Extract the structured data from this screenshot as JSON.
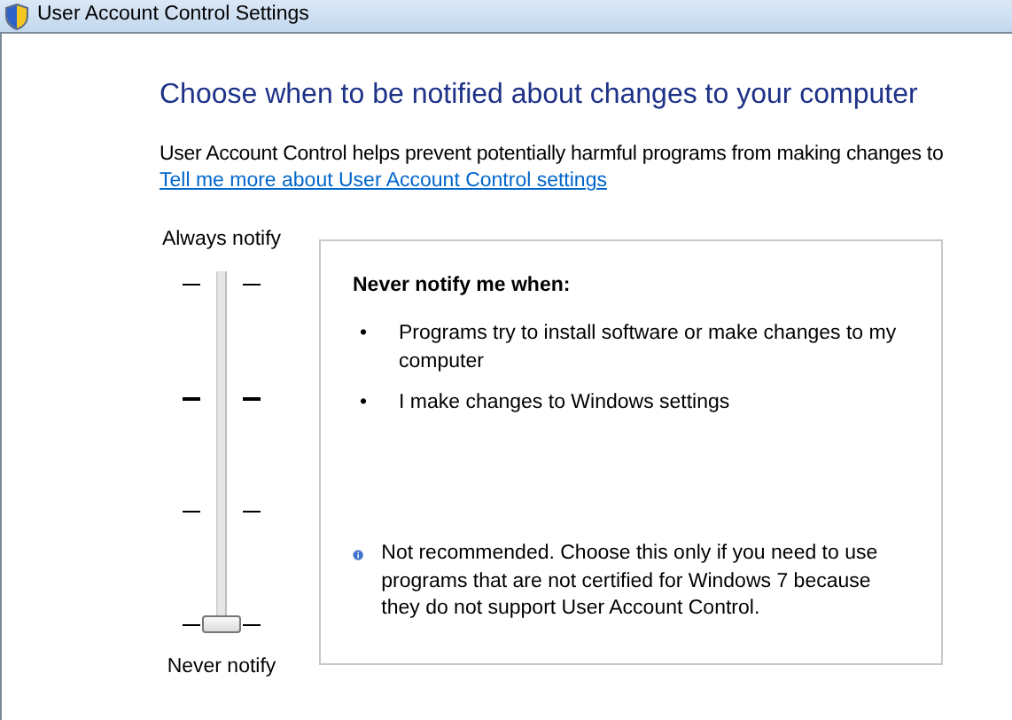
{
  "window": {
    "title": "User Account Control Settings"
  },
  "heading": "Choose when to be notified about changes to your computer",
  "description": "User Account Control helps prevent potentially harmful programs from making changes to",
  "link": "Tell me more about User Account Control settings",
  "slider": {
    "top_label": "Always notify",
    "bottom_label": "Never notify",
    "level": 0
  },
  "panel": {
    "title": "Never notify me when:",
    "bullets": [
      {
        "marker": "•",
        "text": "Programs try to install software or make changes to my computer"
      },
      {
        "marker": "•",
        "text": "I make changes to Windows settings"
      }
    ],
    "note": "Not recommended. Choose this only if you need to use programs that are not certified for Windows 7 because they do not support User Account Control."
  }
}
